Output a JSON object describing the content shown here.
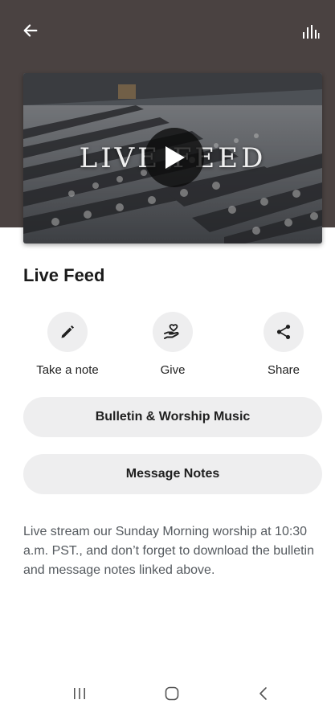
{
  "colors": {
    "header_background": "#4a4241",
    "button_background": "#eeeeef",
    "icon_color": "#1f1f1f",
    "description_color": "#555a5f"
  },
  "header": {
    "back_icon": "arrow-left-icon",
    "audio_icon": "audio-bars-icon"
  },
  "video": {
    "overlay_title": "LIVE FEED",
    "play_icon": "play-icon"
  },
  "page": {
    "title": "Live Feed"
  },
  "actions": [
    {
      "label": "Take a note",
      "icon": "pencil-icon"
    },
    {
      "label": "Give",
      "icon": "heart-hand-icon"
    },
    {
      "label": "Share",
      "icon": "share-icon"
    }
  ],
  "links": [
    {
      "label": "Bulletin & Worship Music"
    },
    {
      "label": "Message Notes"
    }
  ],
  "description": "Live stream our Sunday Morning worship at 10:30 a.m. PST., and don’t forget to download the bulletin and message notes linked above.",
  "navbar": {
    "recents_icon": "recents-icon",
    "home_icon": "home-icon",
    "back_icon": "chevron-left-icon"
  }
}
